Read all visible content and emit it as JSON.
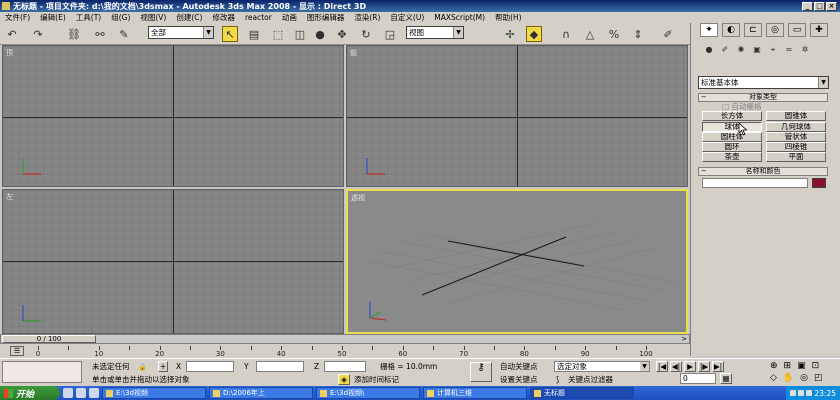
{
  "window": {
    "title": "无标题   - 项目文件夹: d:\\我的文档\\3dsmax    - Autodesk 3ds Max 2008    - 显示 : Direct 3D"
  },
  "menu": [
    "文件(F)",
    "编辑(E)",
    "工具(T)",
    "组(G)",
    "视图(V)",
    "创建(C)",
    "修改器",
    "reactor",
    "动画",
    "图形编辑器",
    "渲染(R)",
    "自定义(U)",
    "MAXScript(M)",
    "帮助(H)"
  ],
  "toolbar": {
    "selection_filter": "全部",
    "reference_coord": "视图"
  },
  "viewports": {
    "top": "顶",
    "front": "前",
    "left": "左",
    "perspective": "透视"
  },
  "command_panel": {
    "category": "标准基本体",
    "object_type_header": "对象类型",
    "autogrid_label": "自动栅格",
    "buttons": [
      "长方体",
      "圆锥体",
      "球体",
      "几何球体",
      "圆柱体",
      "管状体",
      "圆环",
      "四棱锥",
      "茶壶",
      "平面"
    ],
    "pressed_button_index": 2,
    "name_color_header": "名称和颜色",
    "name_value": "",
    "object_color": "#8a1030"
  },
  "timeline": {
    "slider_text": "0 / 100",
    "ticks": [
      "0",
      "10",
      "20",
      "30",
      "40",
      "50",
      "60",
      "70",
      "80",
      "90",
      "100"
    ]
  },
  "status": {
    "selection_state": "未选定任何",
    "x_label": "X",
    "y_label": "Y",
    "z_label": "Z",
    "x_value": "",
    "y_value": "",
    "z_value": "",
    "grid_label": "栅格 = 10.0mm",
    "prompt": "单击或单击并拖动以选择对象",
    "add_time_tag": "添加时间标记",
    "auto_key": "自动关键点",
    "set_key": "设置关键点",
    "key_filter_selector": "选定对象",
    "key_filters": "关键点过滤器",
    "frame": "0"
  },
  "taskbar": {
    "start": "开始",
    "tasks": [
      "E:\\3d视频",
      "D:\\2006年上",
      "E:\\3d视频\\",
      "计算机三维",
      "无标题"
    ],
    "time": "23:25"
  },
  "colors": {
    "accent_active_viewport": "#e8e04a",
    "title_bar": "#0a246a",
    "taskbar": "#2050c0",
    "start_button": "#2a7a2a"
  }
}
